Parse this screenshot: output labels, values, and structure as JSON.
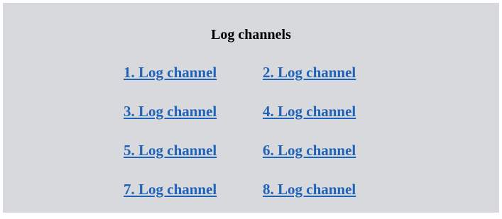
{
  "page": {
    "title": "Log channels"
  },
  "links": [
    "1. Log channel",
    "2. Log channel",
    "3. Log channel",
    "4. Log channel",
    "5. Log channel",
    "6. Log channel",
    "7. Log channel",
    "8. Log channel"
  ],
  "colors": {
    "panel_background": "#d8d9dd",
    "link": "#1f63b8"
  }
}
